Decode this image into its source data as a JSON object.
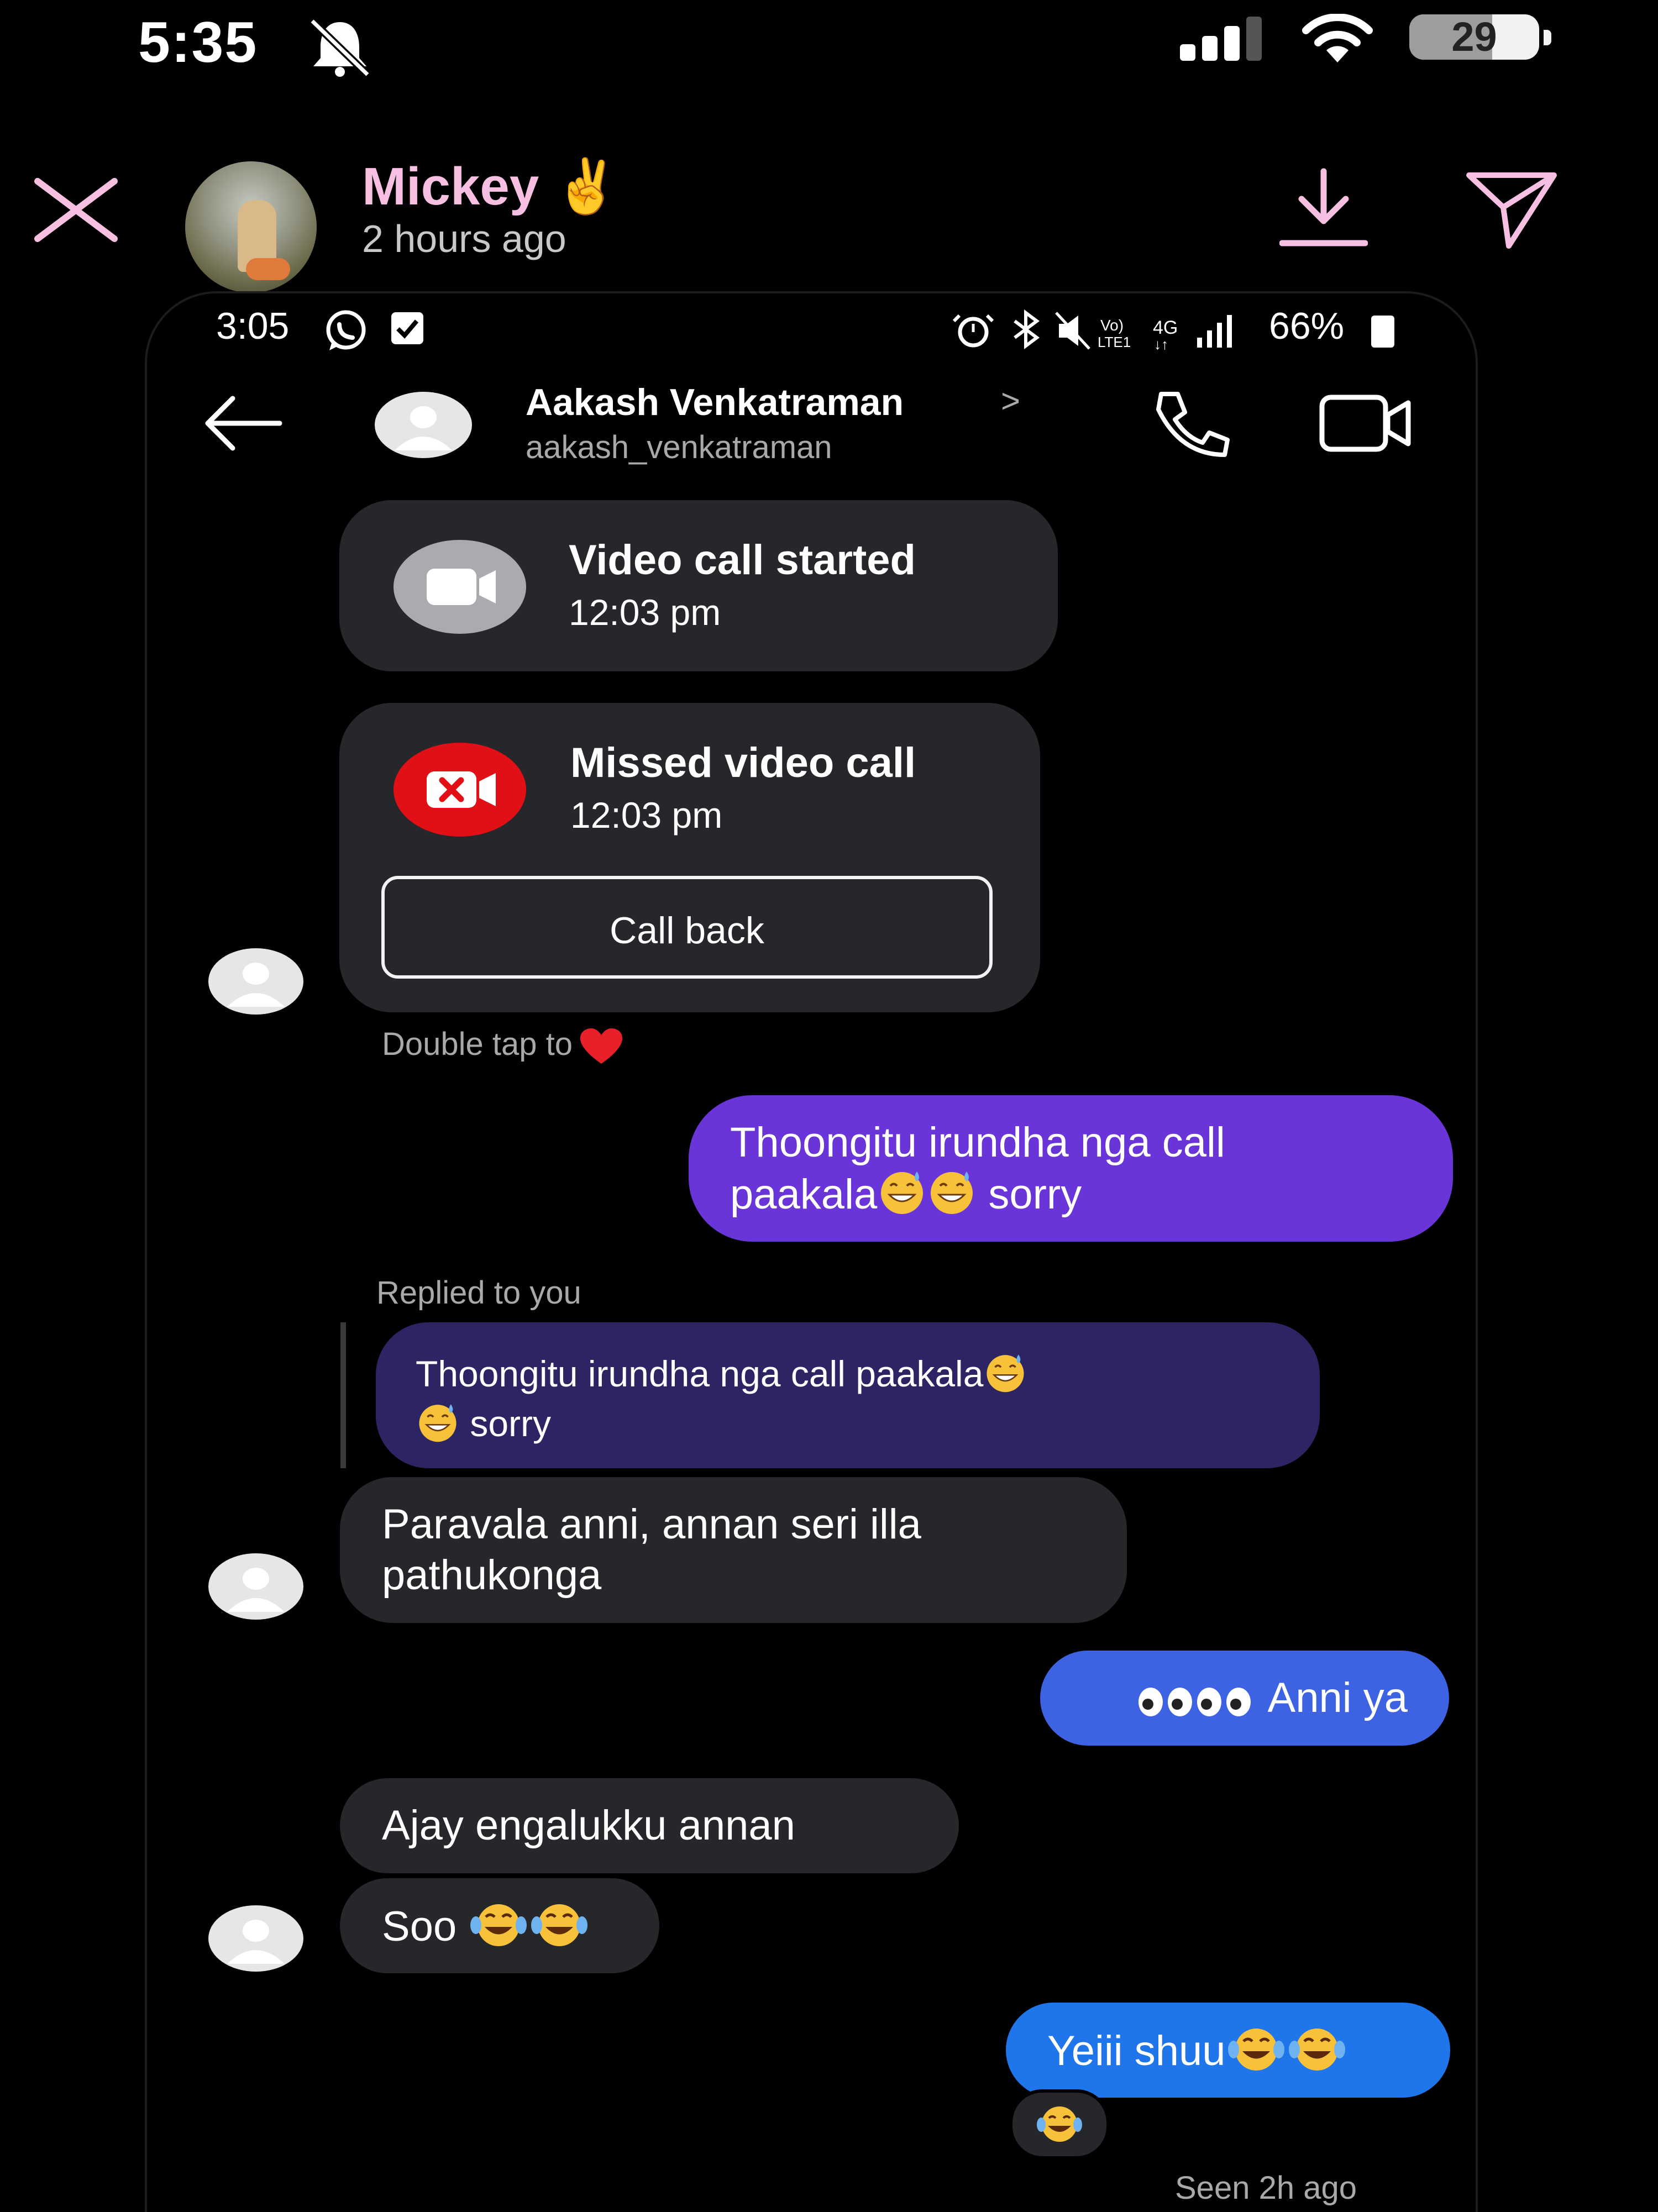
{
  "outer_status": {
    "time": "5:35",
    "battery": "29"
  },
  "story": {
    "name": "Mickey ✌️",
    "time": "2 hours ago"
  },
  "inner_status": {
    "time": "3:05",
    "battery_pct": "66%"
  },
  "chat_header": {
    "name": "Aakash Venkatraman",
    "chevron": ">",
    "username": "aakash_venkatraman"
  },
  "messages": {
    "video_call": {
      "title": "Video call started",
      "time": "12:03 pm"
    },
    "missed_call": {
      "title": "Missed video call",
      "time": "12:03 pm",
      "button": "Call back"
    },
    "double_tap": "Double tap to",
    "m1_line1": "Thoongitu irundha nga call",
    "m1_line2_a": "paakala",
    "m1_line2_b": " sorry",
    "replied_label": "Replied to you",
    "reply_line1": "Thoongitu irundha nga call paakala",
    "reply_line2": " sorry",
    "m2_line1": "Paravala anni, annan seri illa",
    "m2_line2": "pathukonga",
    "m3_text": "Anni ya",
    "m4_text": "Ajay engalukku annan",
    "m5_text": "Soo ",
    "m6_text": "Yeiii shuu",
    "seen": "Seen 2h ago"
  },
  "colors": {
    "story_name": "#f7c0e3",
    "bubble_purple": "#6a35d8",
    "bubble_reply": "#2d2563",
    "bubble_blue": "#3d63e3",
    "bubble_bright_blue": "#1f76ea",
    "incoming_gray": "#26272b",
    "missed_red": "#e11016"
  },
  "icons": [
    "close-icon",
    "download-icon",
    "send-icon",
    "back-arrow-icon",
    "phone-icon",
    "video-camera-icon",
    "whatsapp-icon",
    "checkbox-icon",
    "alarm-icon",
    "bluetooth-icon",
    "mute-icon",
    "signal-icon",
    "wifi-icon",
    "heart-icon",
    "grin-sweat-emoji",
    "tears-of-joy-emoji",
    "eyes-emoji"
  ]
}
